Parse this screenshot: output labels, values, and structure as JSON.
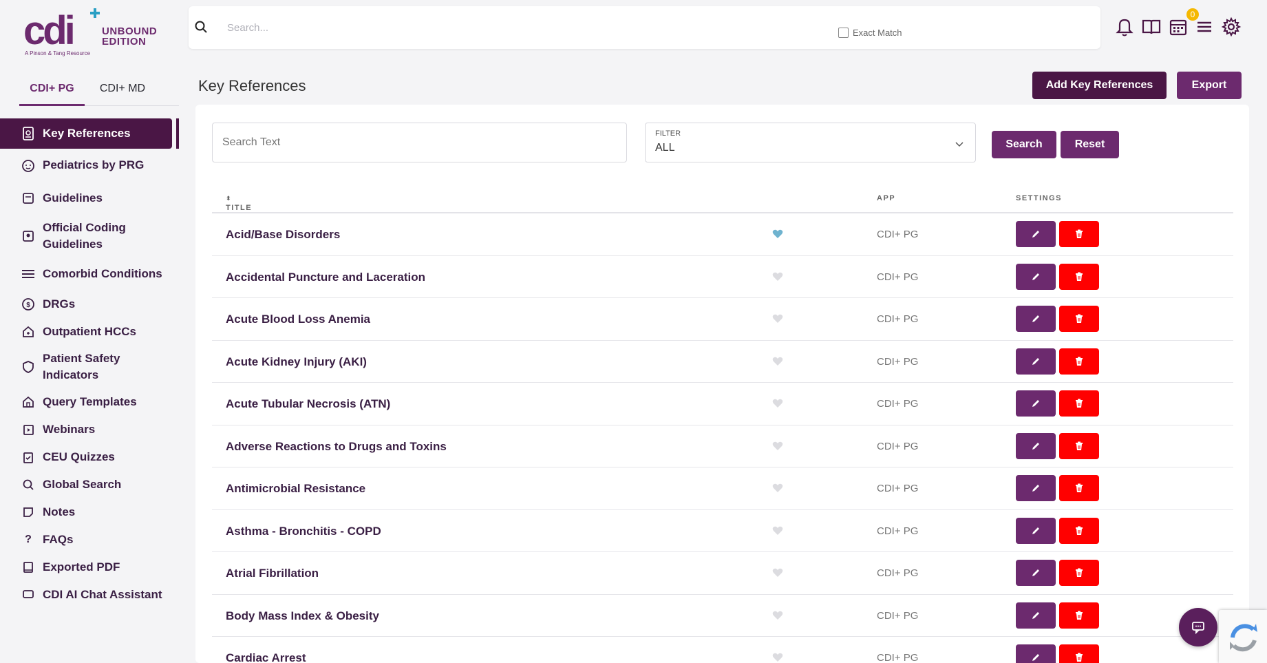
{
  "brand": {
    "logo_text": "cdi",
    "edition_line1": "UNBOUND",
    "edition_line2": "EDITION",
    "tagline": "A Pinson & Tang Resource",
    "primary_color": "#6c2a6e",
    "dark_color": "#4a1645"
  },
  "app_tabs": [
    {
      "label": "CDI+ PG",
      "active": true
    },
    {
      "label": "CDI+ MD",
      "active": false
    }
  ],
  "sidebar": {
    "items": [
      {
        "label": "Key References",
        "icon": "document-icon",
        "active": true
      },
      {
        "label": "Pediatrics by PRG",
        "icon": "baby-icon"
      },
      {
        "label": "Guidelines",
        "icon": "book-icon"
      },
      {
        "label": "Official Coding Guidelines",
        "icon": "badge-book-icon"
      },
      {
        "label": "Comorbid Conditions",
        "icon": "list-icon"
      },
      {
        "label": "DRGs",
        "icon": "coins-icon"
      },
      {
        "label": "Outpatient HCCs",
        "icon": "home-plus-icon"
      },
      {
        "label": "Patient Safety Indicators",
        "icon": "shield-icon"
      },
      {
        "label": "Query Templates",
        "icon": "home-icon"
      },
      {
        "label": "Webinars",
        "icon": "video-icon"
      },
      {
        "label": "CEU Quizzes",
        "icon": "clipboard-check-icon"
      },
      {
        "label": "Global Search",
        "icon": "search-icon"
      },
      {
        "label": "Notes",
        "icon": "note-icon"
      },
      {
        "label": "FAQs",
        "icon": "question-icon"
      },
      {
        "label": "Exported PDF",
        "icon": "book-icon"
      },
      {
        "label": "CDI AI Chat Assistant",
        "icon": "chat-icon"
      }
    ]
  },
  "topbar": {
    "search_placeholder": "Search...",
    "exact_match_label": "Exact Match",
    "calendar_badge": "0"
  },
  "page": {
    "title": "Key References",
    "add_button": "Add Key References",
    "export_button": "Export",
    "search_text_placeholder": "Search Text",
    "filter_label": "FILTER",
    "filter_value": "ALL",
    "search_button": "Search",
    "reset_button": "Reset"
  },
  "table": {
    "headers": {
      "title": "TITLE",
      "app": "APP",
      "settings": "SETTINGS"
    },
    "rows": [
      {
        "title": "Acid/Base Disorders",
        "app": "CDI+ PG",
        "favorite": true
      },
      {
        "title": "Accidental Puncture and Laceration",
        "app": "CDI+ PG",
        "favorite": false
      },
      {
        "title": "Acute Blood Loss Anemia",
        "app": "CDI+ PG",
        "favorite": false
      },
      {
        "title": "Acute Kidney Injury (AKI)",
        "app": "CDI+ PG",
        "favorite": false
      },
      {
        "title": "Acute Tubular Necrosis (ATN)",
        "app": "CDI+ PG",
        "favorite": false
      },
      {
        "title": "Adverse Reactions to Drugs and Toxins",
        "app": "CDI+ PG",
        "favorite": false
      },
      {
        "title": "Antimicrobial Resistance",
        "app": "CDI+ PG",
        "favorite": false
      },
      {
        "title": "Asthma - Bronchitis - COPD",
        "app": "CDI+ PG",
        "favorite": false
      },
      {
        "title": "Atrial Fibrillation",
        "app": "CDI+ PG",
        "favorite": false
      },
      {
        "title": "Body Mass Index & Obesity",
        "app": "CDI+ PG",
        "favorite": false
      },
      {
        "title": "Cardiac Arrest",
        "app": "CDI+ PG",
        "favorite": false
      }
    ]
  }
}
